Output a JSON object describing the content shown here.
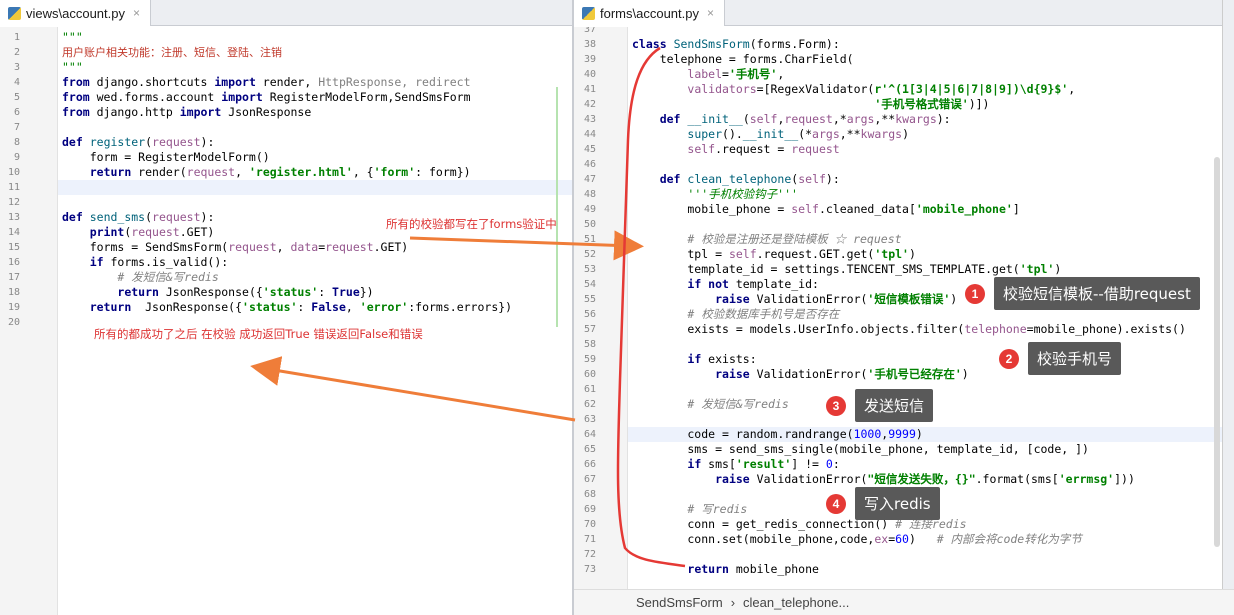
{
  "left_tab": {
    "title": "views\\account.py",
    "close": "×"
  },
  "right_tab": {
    "title": "forms\\account.py",
    "close": "×"
  },
  "left_lines": [
    "1",
    "2",
    "3",
    "4",
    "5",
    "6",
    "7",
    "8",
    "9",
    "10",
    "11",
    "12",
    "13",
    "14",
    "15",
    "16",
    "17",
    "18",
    "19",
    "20"
  ],
  "right_lines": [
    "37",
    "38",
    "39",
    "40",
    "41",
    "42",
    "43",
    "44",
    "45",
    "46",
    "47",
    "48",
    "49",
    "50",
    "51",
    "52",
    "53",
    "54",
    "55",
    "56",
    "57",
    "58",
    "59",
    "60",
    "61",
    "62",
    "63",
    "64",
    "65",
    "66",
    "67",
    "68",
    "69",
    "70",
    "71",
    "72",
    "73"
  ],
  "annotations": {
    "forms_note": "所有的校验都写在了forms验证中",
    "success_note": "所有的都成功了之后 在校验 成功返回True 错误返回False和错误"
  },
  "callouts": [
    {
      "num": "1",
      "text": "校验短信模板--借助request"
    },
    {
      "num": "2",
      "text": "校验手机号"
    },
    {
      "num": "3",
      "text": "发送短信"
    },
    {
      "num": "4",
      "text": "写入redis"
    }
  ],
  "breadcrumb": {
    "class": "SendSmsForm",
    "sep": "›",
    "method": "clean_telephone..."
  },
  "colors": {
    "arrow": "#ef7d39",
    "red_bracket": "#e53935",
    "badge": "#e53935"
  }
}
